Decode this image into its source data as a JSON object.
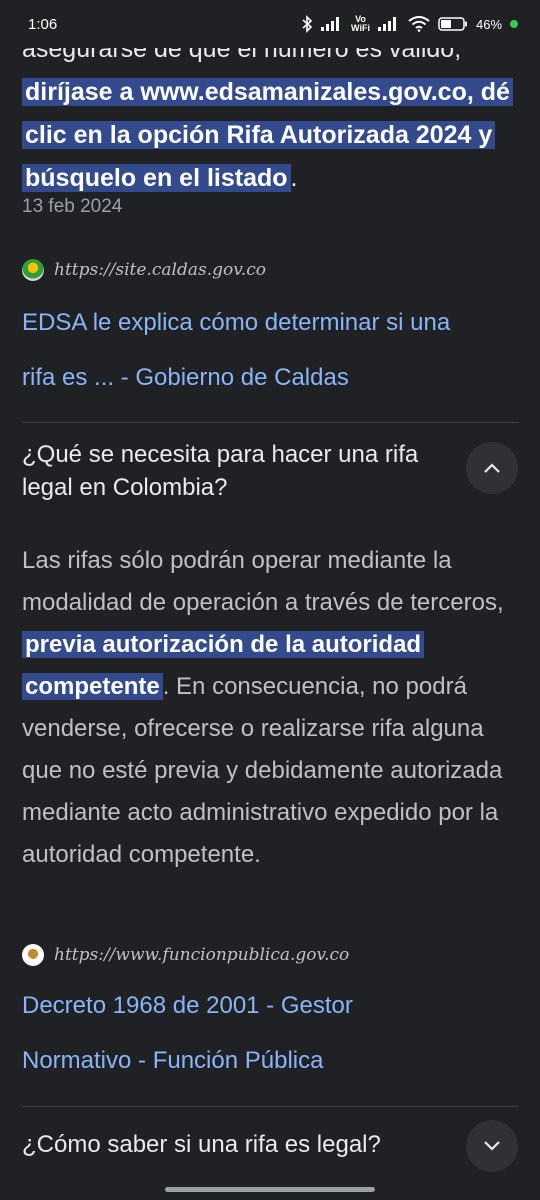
{
  "status_bar": {
    "time": "1:06",
    "volte_top": "Vo",
    "volte_bottom": "WiFi",
    "battery": "46"
  },
  "snippet_top": {
    "plain_start": "asegurarse de que el número es válido,",
    "highlight": "diríjase a www.edsamanizales.gov.co, dé clic en la opción Rifa Autorizada 2024 y búsquelo en el listado",
    "plain_end": ".",
    "date": "13 feb 2024"
  },
  "result_1": {
    "url": "https://site.caldas.gov.co",
    "title_line1": "EDSA le explica cómo determinar si una",
    "title_line2": "rifa es ... - Gobierno de Caldas"
  },
  "question_1": {
    "text": "¿Qué se necesita para hacer una rifa legal en Colombia?",
    "expanded": true,
    "answer_start": "Las rifas sólo podrán operar mediante la modalidad de operación a través de terceros,",
    "answer_highlight": "previa autorización de la autoridad competente",
    "answer_end": ". En consecuencia, no podrá venderse, ofrecerse o realizarse rifa alguna que no esté previa y debidamente autorizada mediante acto administrativo expedido por la autoridad competente."
  },
  "result_2": {
    "url": "https://www.funcionpublica.gov.co",
    "title_line1": "Decreto 1968 de 2001 - Gestor",
    "title_line2": "Normativo - Función Pública"
  },
  "question_2": {
    "text": "¿Cómo saber si una rifa es legal?",
    "expanded": false
  },
  "colors": {
    "background": "#202124",
    "highlight": "#334a8c",
    "link": "#8ab4f8",
    "text": "#e8eaed",
    "secondary_text": "#bdc1c6"
  }
}
